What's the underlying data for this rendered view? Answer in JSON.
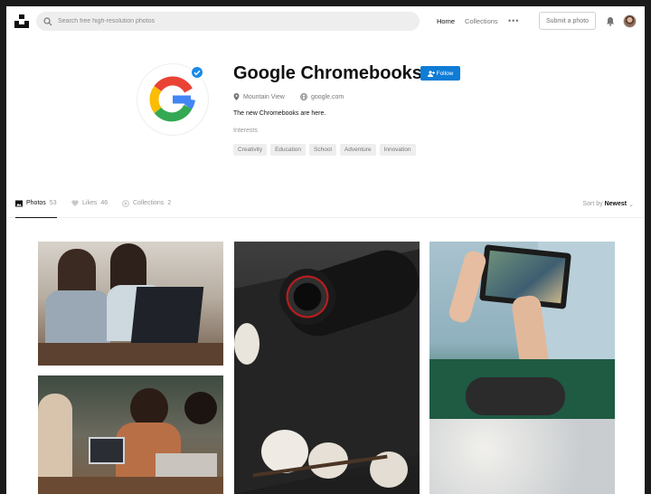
{
  "nav": {
    "search_placeholder": "Search free high-resolution photos",
    "home": "Home",
    "collections": "Collections",
    "more": "•••",
    "submit_photo": "Submit a photo"
  },
  "profile": {
    "name": "Google Chromebooks",
    "follow_label": "Follow",
    "location": "Mountain View",
    "website": "google.com",
    "bio": "The new Chromebooks are here.",
    "interests_label": "Interests",
    "interests": [
      "Creativity",
      "Education",
      "School",
      "Adventure",
      "Innovation"
    ]
  },
  "tabs": [
    {
      "label": "Photos",
      "count": "53",
      "icon": "image-icon",
      "active": true
    },
    {
      "label": "Likes",
      "count": "46",
      "icon": "heart-icon",
      "active": false
    },
    {
      "label": "Collections",
      "count": "2",
      "icon": "collections-icon",
      "active": false
    }
  ],
  "sort": {
    "prefix": "Sort by",
    "value": "Newest"
  },
  "colors": {
    "accent": "#0f7cd6",
    "verified": "#1a8ae8"
  },
  "photos": [
    {
      "description": "two women working on a Chromebook laptop"
    },
    {
      "description": "camera lens on a Samsung Chromebook with cotton"
    },
    {
      "description": "hands holding a tablet over a knit blanket"
    },
    {
      "description": "group of friends laughing with laptops"
    }
  ]
}
